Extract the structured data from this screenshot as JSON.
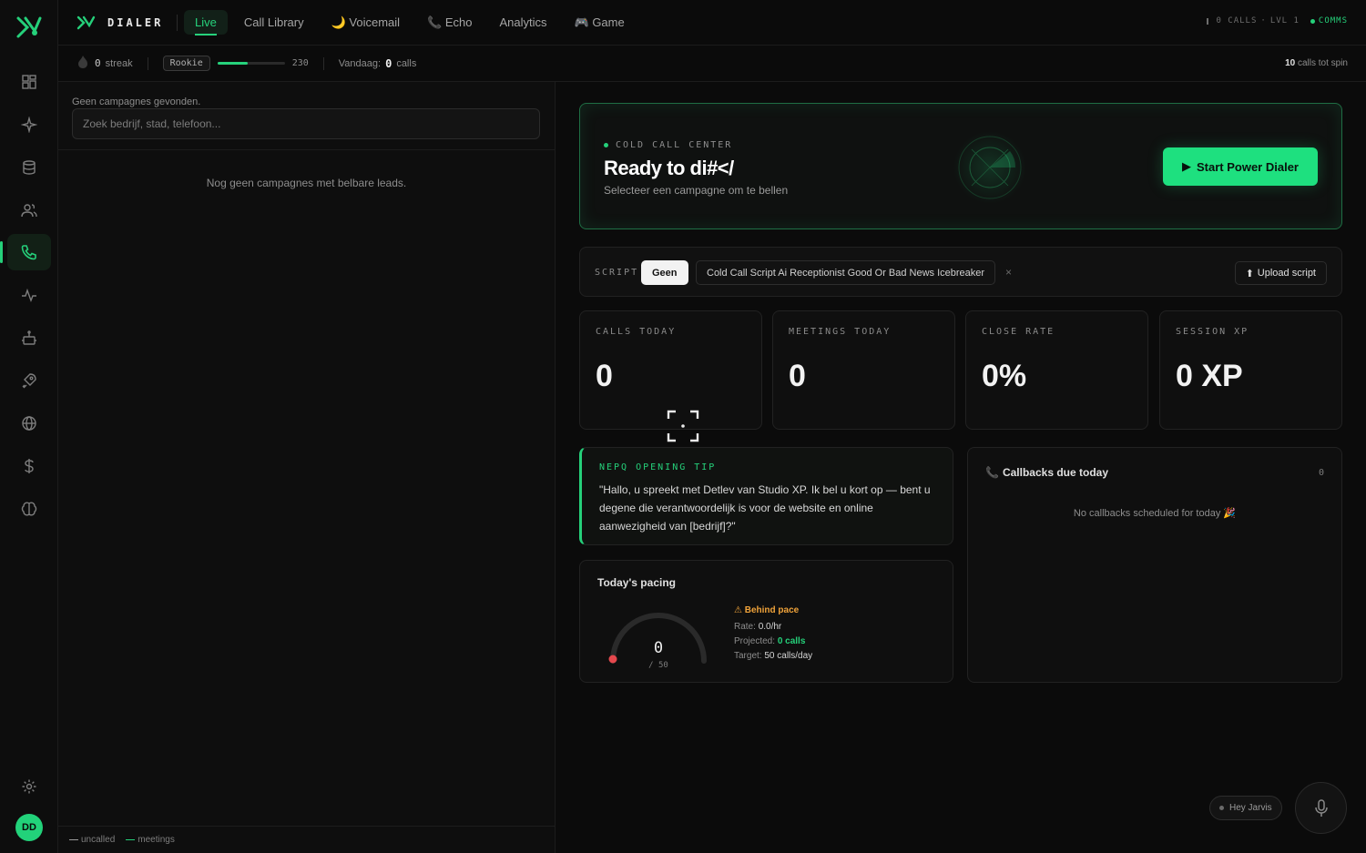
{
  "app": {
    "brand": "DIALER",
    "user_initials": "DD"
  },
  "nav": {
    "tabs": [
      "Live",
      "Call Library",
      "🌙 Voicemail",
      "📞 Echo",
      "Analytics",
      "🎮 Game"
    ],
    "active": "Live"
  },
  "sidebar": {
    "icons": [
      "dashboard-icon",
      "sparkle-icon",
      "database-icon",
      "users-icon",
      "phone-icon",
      "activity-icon",
      "bot-icon",
      "rocket-icon",
      "globe-icon",
      "dollar-icon",
      "brain-icon"
    ],
    "active_icon": "phone-icon",
    "settings_icon": "gear-icon"
  },
  "top_status": {
    "calls": "0 CALLS",
    "level": "LVL 1",
    "comms": "COMMS"
  },
  "subbar": {
    "streak_value": "0",
    "streak_label": "streak",
    "rank": "Rookie",
    "xp_progress": 0.45,
    "xp_value": "230",
    "today_label": "Vandaag:",
    "today_value": "0",
    "today_unit": "calls",
    "spin_value": "10",
    "spin_label": "calls tot spin"
  },
  "leftpanel": {
    "no_campaigns": "Geen campagnes gevonden.",
    "search_placeholder": "Zoek bedrijf, stad, telefoon...",
    "empty_text": "Nog geen campagnes met belbare leads.",
    "legend": [
      {
        "label": "uncalled",
        "color": "#9a9a9a"
      },
      {
        "label": "meetings",
        "color": "#25d07a"
      }
    ]
  },
  "hero": {
    "kicker": "COLD CALL CENTER",
    "title": "Ready to di#</",
    "subtitle": "Selecteer een campagne om te bellen",
    "start_button": "Start Power Dialer"
  },
  "script": {
    "label": "SCRIPT",
    "selected": "Geen",
    "option": "Cold Call Script Ai Receptionist Good Or Bad News Icebreaker",
    "remove": "×",
    "upload": "Upload script"
  },
  "stats": [
    {
      "label": "CALLS TODAY",
      "value": "0"
    },
    {
      "label": "MEETINGS TODAY",
      "value": "0"
    },
    {
      "label": "CLOSE RATE",
      "value": "0%"
    },
    {
      "label": "SESSION XP",
      "value": "0 XP"
    }
  ],
  "tip": {
    "label": "NEPQ OPENING TIP",
    "text": "\"Hallo, u spreekt met Detlev van Studio XP. Ik bel u kort op — bent u degene die verantwoordelijk is voor de website en online aanwezigheid van [bedrijf]?\""
  },
  "callbacks": {
    "title": "Callbacks due today",
    "count": "0",
    "empty": "No callbacks scheduled for today 🎉"
  },
  "pacing": {
    "title": "Today's pacing",
    "current": "0",
    "target_sub": "/ 50",
    "progress": 0,
    "status": "⚠ Behind pace",
    "rate_label": "Rate:",
    "rate_value": "0.0/hr",
    "projected_label": "Projected:",
    "projected_value": "0 calls",
    "target_label": "Target:",
    "target_value": "50 calls/day"
  },
  "assistant": {
    "hey": "Hey Jarvis"
  },
  "colors": {
    "accent": "#25d07a",
    "warning": "#f0a33a",
    "danger": "#e5484d"
  }
}
